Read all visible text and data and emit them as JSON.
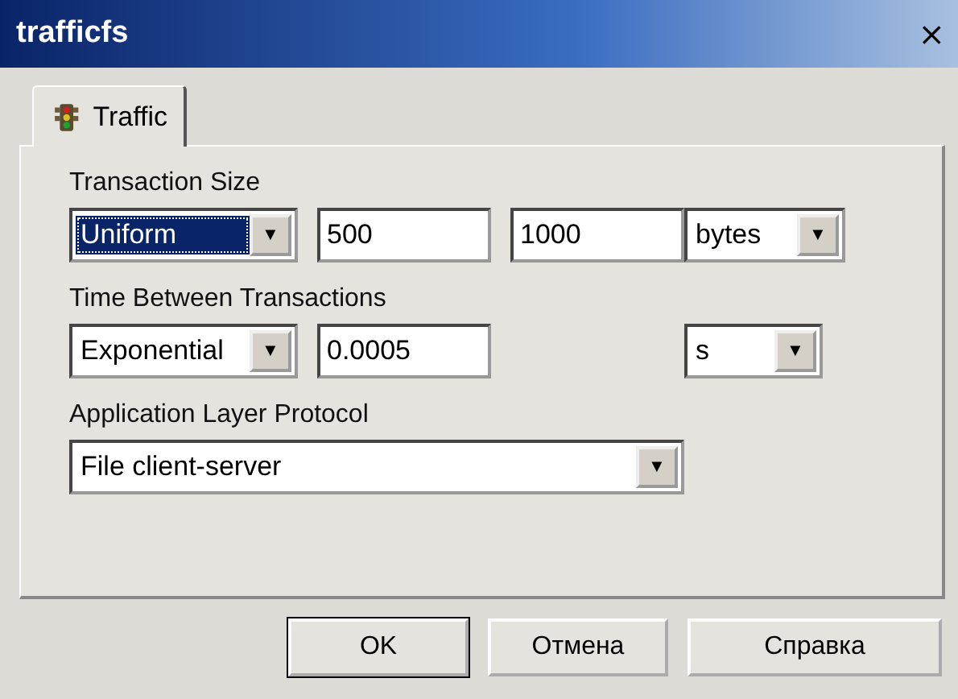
{
  "window": {
    "title": "trafficfs",
    "close": "×"
  },
  "tabs": [
    {
      "label": "Traffic",
      "selected": true
    }
  ],
  "sections": [
    {
      "label": "Transaction Size",
      "controls": [
        {
          "kind": "combo",
          "value": "Uniform",
          "focused": true,
          "arrow": "▼"
        },
        {
          "kind": "field",
          "value": "500"
        },
        {
          "kind": "field",
          "value": "1000"
        },
        {
          "kind": "units",
          "value": "bytes",
          "focused": false,
          "arrow": "▼"
        }
      ]
    },
    {
      "label": "Time Between Transactions",
      "controls": [
        {
          "kind": "combo",
          "value": "Exponential",
          "focused": false,
          "arrow": "▼"
        },
        {
          "kind": "field",
          "value": "0.0005"
        },
        {
          "kind": "units",
          "value": "s",
          "focused": false,
          "arrow": "▼"
        }
      ]
    },
    {
      "label": "Application Layer Protocol",
      "controls": [
        {
          "kind": "wide",
          "value": "File client-server",
          "focused": false,
          "arrow": "▼"
        }
      ]
    }
  ],
  "buttons": [
    {
      "label": "OK",
      "default": true
    },
    {
      "label": "Отмена",
      "default": false
    },
    {
      "label": "Справка",
      "default": false
    }
  ]
}
